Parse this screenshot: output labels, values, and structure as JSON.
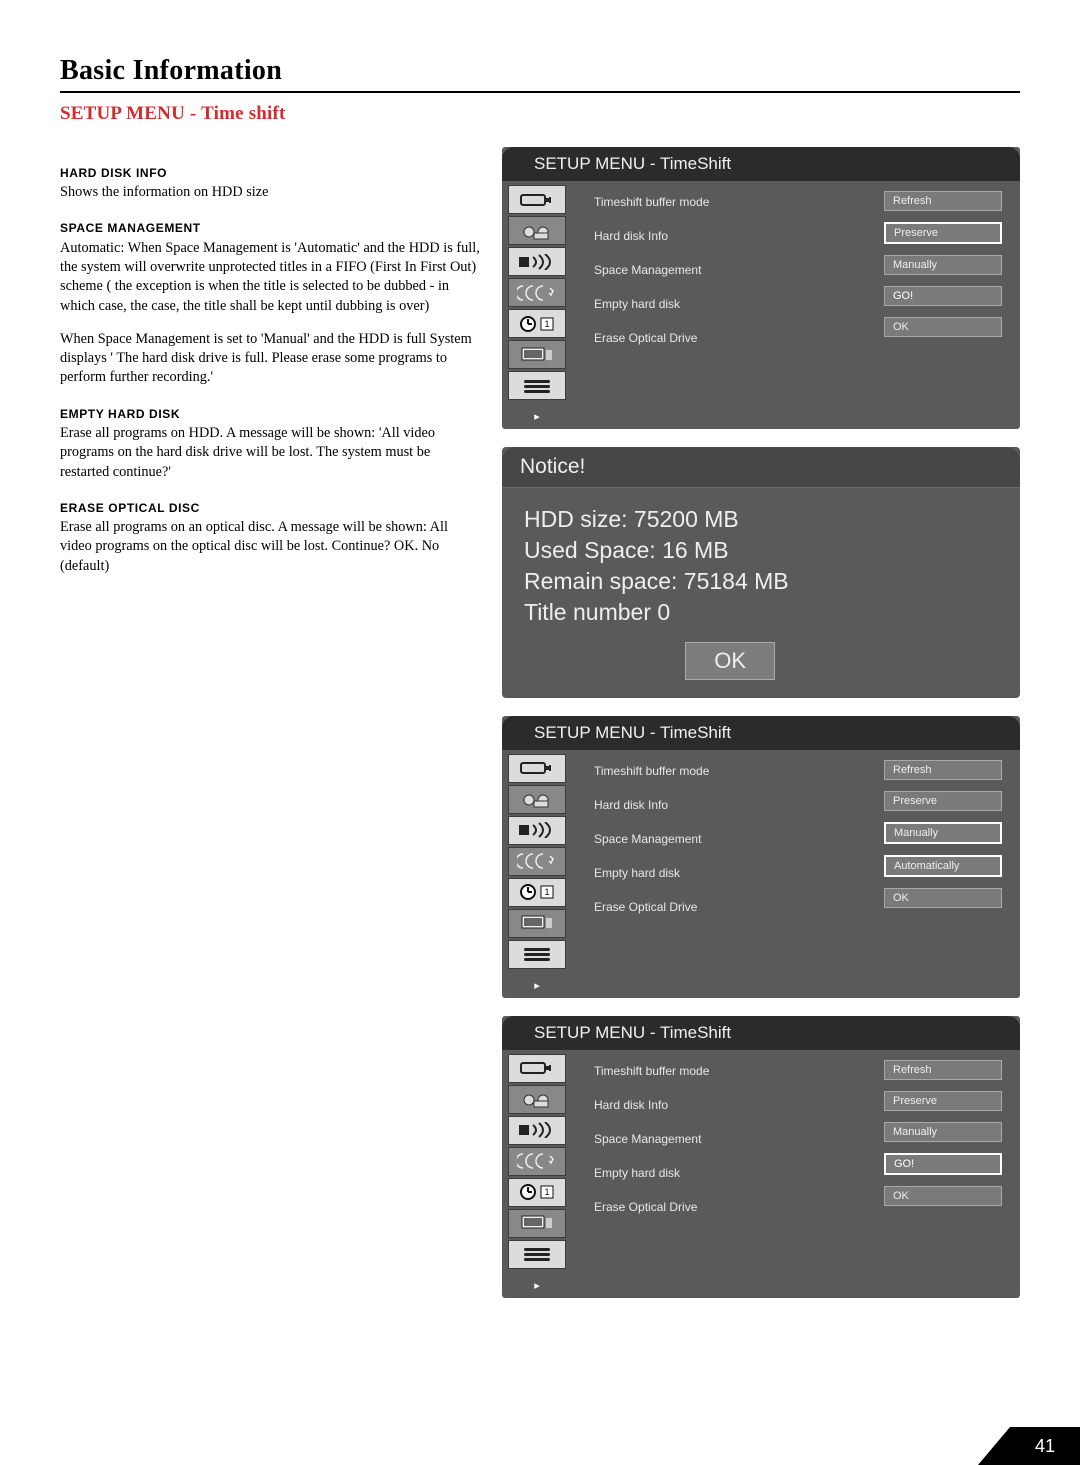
{
  "page": {
    "title": "Basic Information",
    "section": "SETUP MENU - Time shift",
    "number": "41"
  },
  "explain": {
    "hd_heading": "HARD DISK INFO",
    "hd_text": "Shows the information on HDD size",
    "sm_heading": "SPACE MANAGEMENT",
    "sm_para1": "Automatic: When Space Management is 'Automatic' and the HDD is full, the system will overwrite unprotected titles in a FIFO (First In First Out) scheme ( the exception is when the title is  selected to be dubbed - in which case, the case, the title shall be kept until dubbing is over)",
    "sm_para2": "When Space Management is set to 'Manual' and the HDD is full System displays ' The hard disk drive is full. Please erase some programs to perform further recording.'",
    "ehd_heading": "EMPTY HARD DISK",
    "ehd_text": "Erase all programs on HDD. A message will be shown: 'All video programs on the hard disk drive will be lost. The system must be restarted continue?'",
    "eod_heading": "ERASE OPTICAL DISC",
    "eod_text": "Erase all programs on an optical disc. A message will be shown: All video programs on the optical disc will be lost. Continue? OK. No (default)"
  },
  "osd_title": "SETUP MENU - TimeShift",
  "menu_labels": {
    "l1": "Timeshift buffer mode",
    "l2": "Hard disk Info",
    "l3": "Space Management",
    "l4": "Empty hard disk",
    "l5": "Erase Optical Drive"
  },
  "panel1": {
    "v1": "Refresh",
    "v2": "Preserve",
    "v3": "Manually",
    "v4": "GO!",
    "v5": "OK"
  },
  "panel3": {
    "v1": "Refresh",
    "v2": "Preserve",
    "v3": "Manually",
    "v4": "Automatically",
    "v5": "OK"
  },
  "panel4": {
    "v1": "Refresh",
    "v2": "Preserve",
    "v3": "Manually",
    "v4": "GO!",
    "v5": "OK"
  },
  "arrow_char": "▸",
  "notice": {
    "title": "Notice!",
    "line1": "HDD size: 75200 MB",
    "line2": "Used Space: 16 MB",
    "line3": "Remain space: 75184 MB",
    "line4": "Title number 0",
    "ok": "OK"
  }
}
